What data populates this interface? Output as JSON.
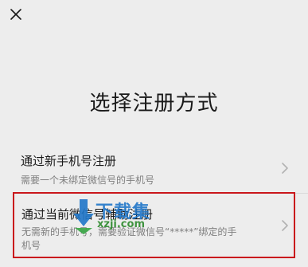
{
  "header": {
    "close_icon": "close-icon"
  },
  "page": {
    "title": "选择注册方式"
  },
  "options": [
    {
      "title": "通过新手机号注册",
      "description": "需要一个未绑定微信号的手机号",
      "icon": "chevron-right-icon"
    },
    {
      "title": "通过当前微信号辅助注册",
      "description": "无需新的手机号，需要验证微信号“*****”绑定的手机号",
      "icon": "chevron-right-icon",
      "highlight_color": "#c9171c"
    }
  ],
  "watermark": {
    "text": "下载集",
    "url": "xzji.com"
  }
}
